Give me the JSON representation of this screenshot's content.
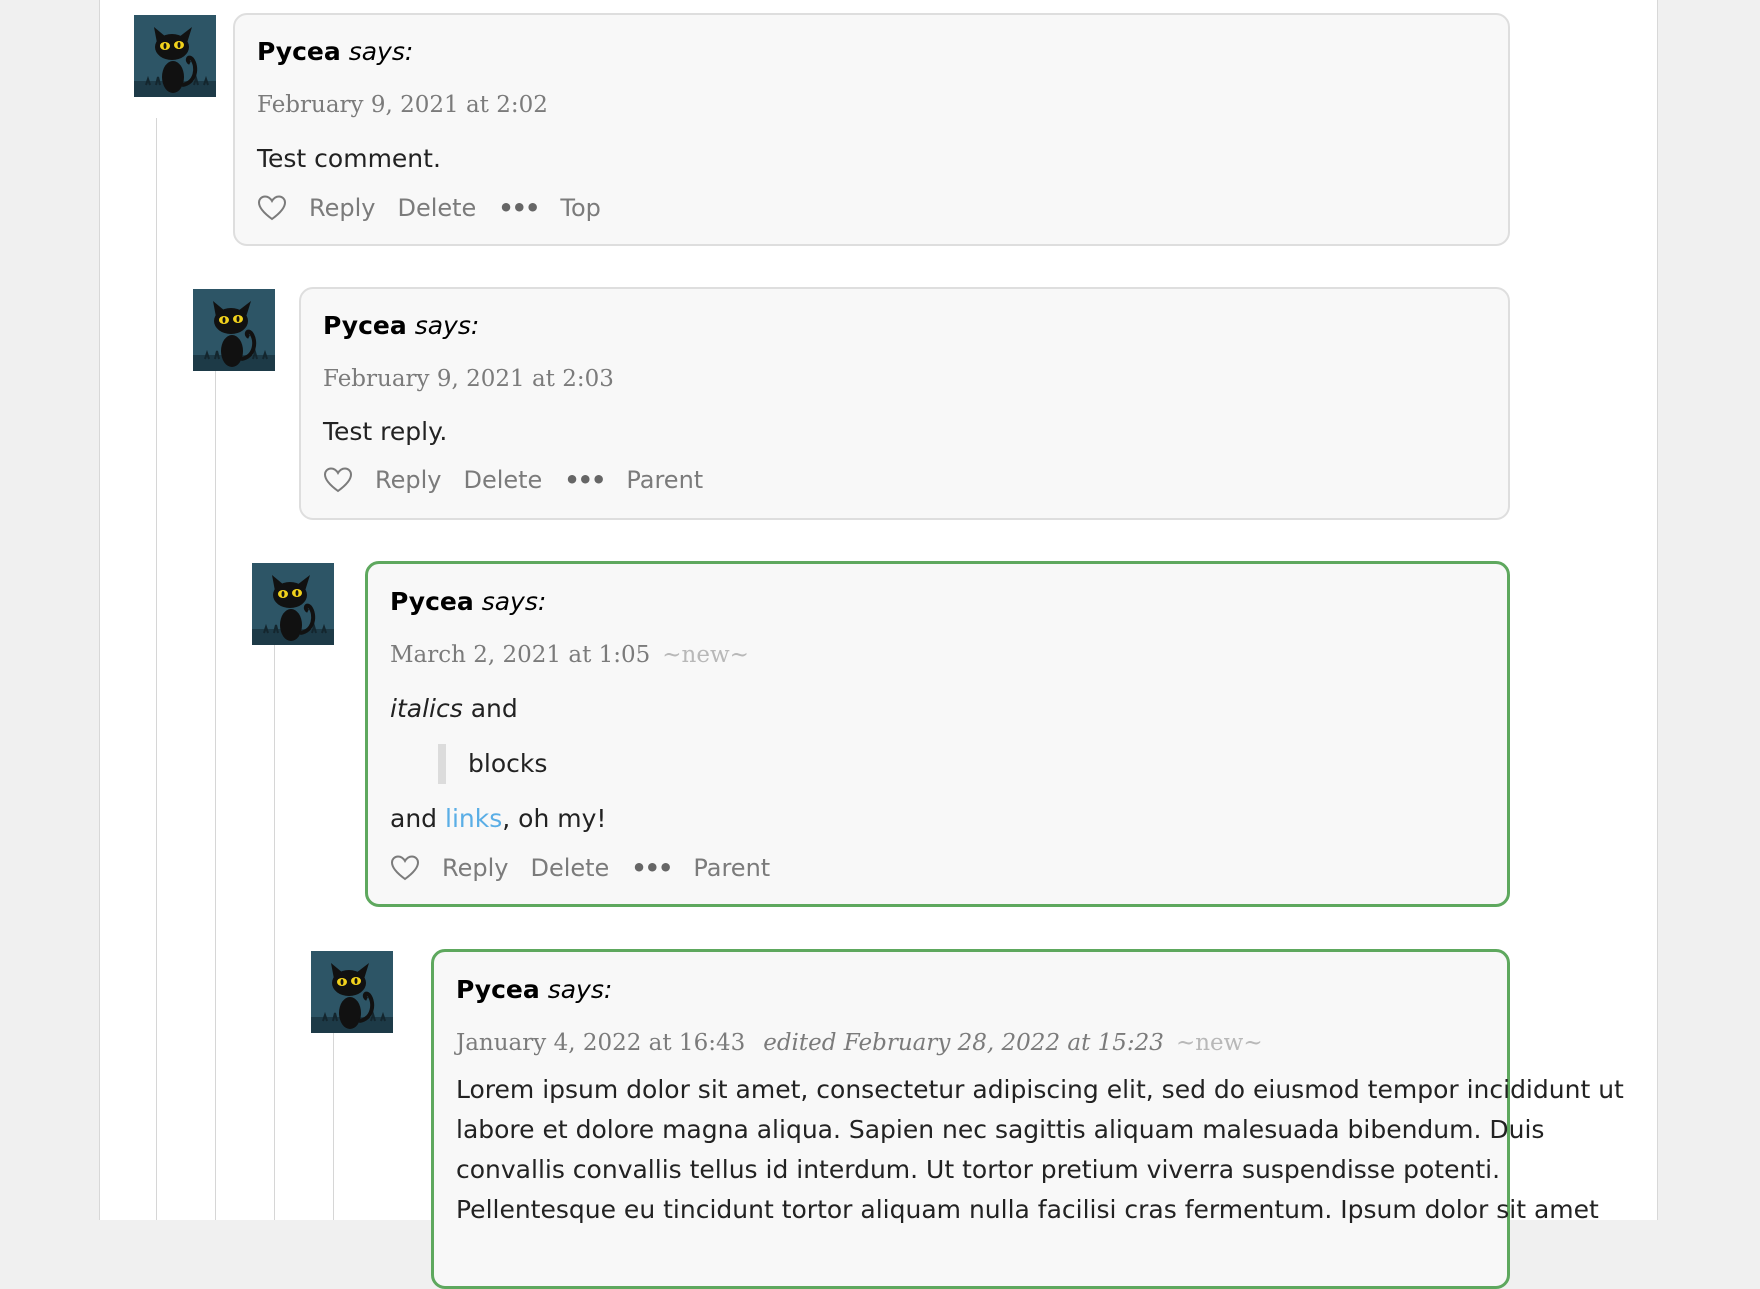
{
  "comments": [
    {
      "author": "Pycea",
      "says": "says:",
      "date": "February 9, 2021 at 2:02",
      "body": "Test comment.",
      "actions": {
        "reply": "Reply",
        "delete": "Delete",
        "more": "•••",
        "nav": "Top"
      }
    },
    {
      "author": "Pycea",
      "says": "says:",
      "date": "February 9, 2021 at 2:03",
      "body": "Test reply.",
      "actions": {
        "reply": "Reply",
        "delete": "Delete",
        "more": "•••",
        "nav": "Parent"
      }
    },
    {
      "author": "Pycea",
      "says": "says:",
      "date": "March 2, 2021 at 1:05",
      "new_tag": "~new~",
      "body_italic": "italics",
      "body_and": "and",
      "quote": "blocks",
      "body_and2": "and",
      "link": "links",
      "body_end": ", oh my!",
      "actions": {
        "reply": "Reply",
        "delete": "Delete",
        "more": "•••",
        "nav": "Parent"
      }
    },
    {
      "author": "Pycea",
      "says": "says:",
      "date": "January 4, 2022 at 16:43",
      "edited": "edited February 28, 2022 at 15:23",
      "new_tag": "~new~",
      "body": "Lorem ipsum dolor sit amet, consectetur adipiscing elit, sed do eiusmod tempor incididunt ut labore et dolore magna aliqua. Sapien nec sagittis aliquam malesuada bibendum. Duis convallis convallis tellus id interdum. Ut tortor pretium viverra suspendisse potenti. Pellentesque eu tincidunt tortor aliquam nulla facilisi cras fermentum. Ipsum dolor sit amet"
    }
  ],
  "colors": {
    "new_border": "#5ea85e",
    "link": "#5aaee6"
  }
}
